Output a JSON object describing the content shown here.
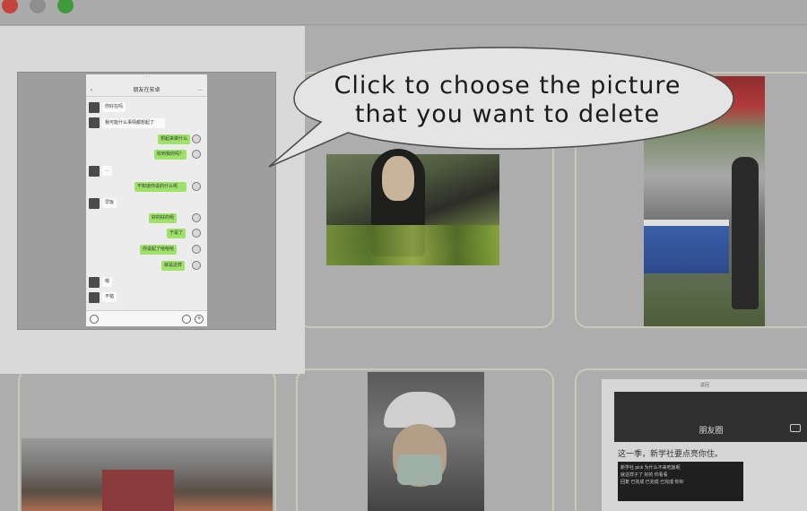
{
  "window": {
    "close_icon": "close-icon",
    "minimize_icon": "minimize-icon",
    "maximize_icon": "maximize-icon"
  },
  "tooltip": {
    "line1": "Click to choose the picture",
    "line2": "that you want to delete"
  },
  "selected_photo": {
    "chat_title": "朋友在安卓",
    "messages_left": [
      "你好在吗",
      "我可能什么事情都想起了",
      "…",
      "早饭",
      "嗯",
      "不错"
    ],
    "messages_right": [
      "想起来做什么",
      "收到我的吗？",
      "不知道你说的什么呢",
      "好的好的呢",
      "于是了",
      "你说起了哈哈哈",
      "就是这样"
    ]
  },
  "moments_photo": {
    "top_label": "返回",
    "title": "朋友圈",
    "line1": "这一季，新学社要点亮你住。",
    "block_lines": [
      "新学社 pick 为什么不来吃饭呢",
      "就这样子了 好的 你看看",
      "回复 已完成 已完成 已完成 你好"
    ]
  },
  "colors": {
    "bubble_fill": "#e4e4e4",
    "bubble_stroke": "#4a4a4a",
    "chat_green": "#9ee26a"
  }
}
